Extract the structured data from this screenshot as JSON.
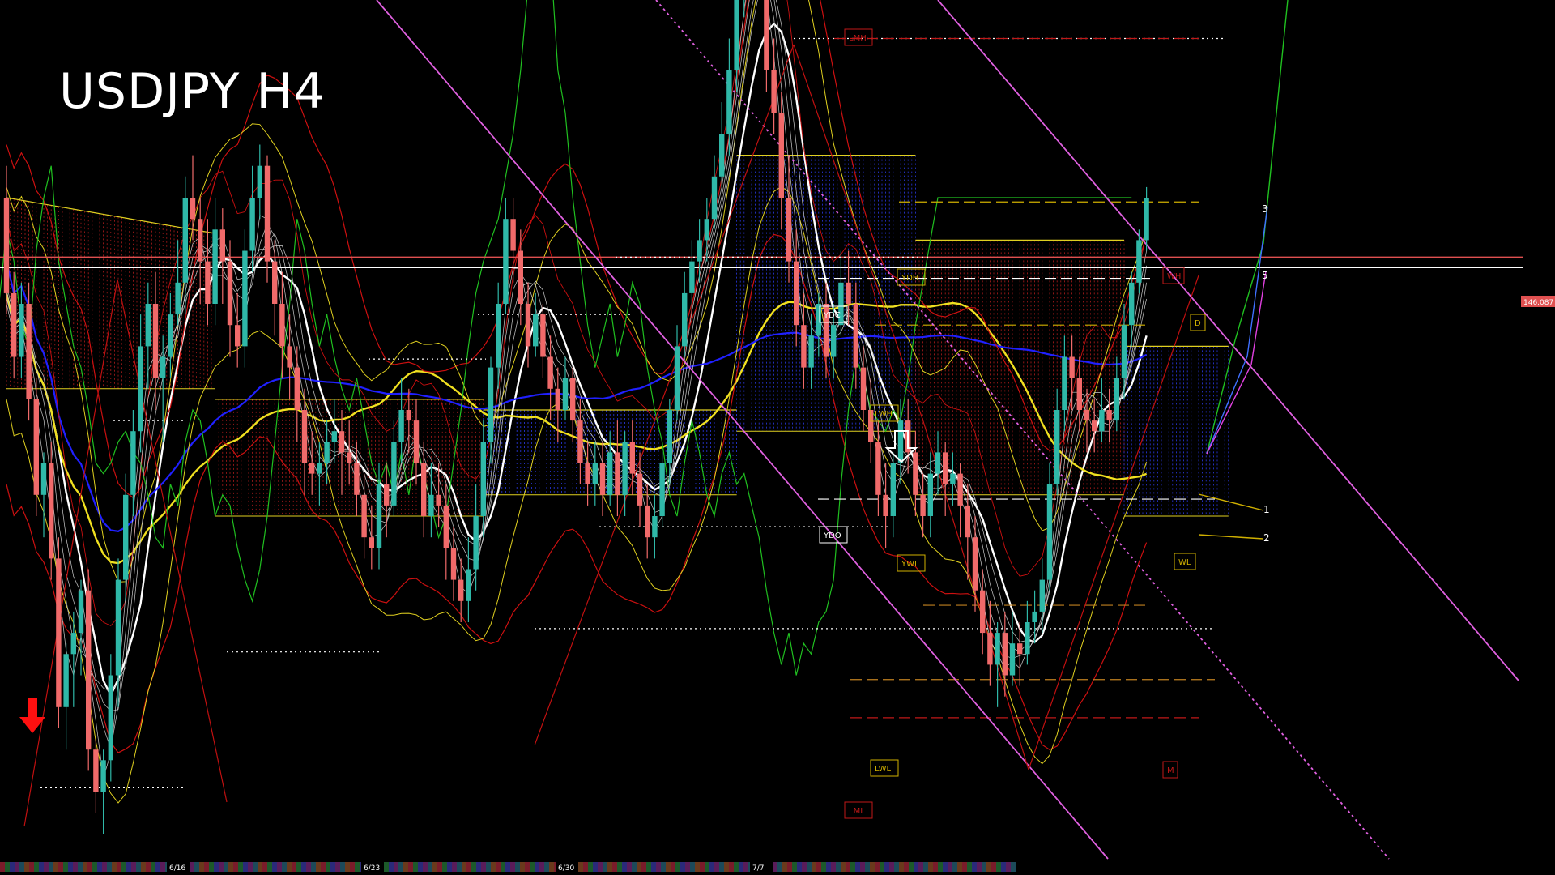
{
  "chart_data": {
    "type": "candlestick",
    "title": "USDJPY H4",
    "colors": {
      "bull": "#2fb8a8",
      "bear": "#f06a6a",
      "ma_white": "#ffffff",
      "ma_yellow": "#f0e020",
      "ma_blue": "#2020ff",
      "green": "#20c020",
      "red_env": "#cc1010",
      "cloud_red": "#c02020",
      "cloud_blue": "#3040ff",
      "cloud_edge": "#e0d020",
      "trend_violet": "#e060e0",
      "level_white": "#ffffff",
      "price_line": "#e05050"
    },
    "price_tag": "146.087",
    "date_labels": [
      "6/16",
      "6/23",
      "6/30",
      "7/7"
    ],
    "level_tags": [
      "LMH",
      "YDH",
      "YDC",
      "YDO",
      "LWH",
      "YWL",
      "LWL",
      "LML",
      "WH",
      "WL",
      "D",
      "M"
    ],
    "projection_labels": [
      "3",
      "5",
      "1",
      "2"
    ],
    "candles": [
      [
        300,
        255,
        315,
        245
      ],
      [
        255,
        225,
        265,
        215
      ],
      [
        225,
        250,
        260,
        215
      ],
      [
        250,
        205,
        260,
        195
      ],
      [
        205,
        160,
        215,
        150
      ],
      [
        160,
        175,
        180,
        140
      ],
      [
        175,
        130,
        185,
        120
      ],
      [
        130,
        60,
        140,
        50
      ],
      [
        60,
        85,
        90,
        40
      ],
      [
        85,
        95,
        105,
        60
      ],
      [
        95,
        115,
        120,
        75
      ],
      [
        115,
        40,
        125,
        30
      ],
      [
        40,
        20,
        45,
        10
      ],
      [
        20,
        35,
        40,
        0
      ],
      [
        35,
        75,
        85,
        25
      ],
      [
        75,
        120,
        130,
        60
      ],
      [
        120,
        160,
        170,
        110
      ],
      [
        160,
        190,
        200,
        150
      ],
      [
        190,
        230,
        245,
        180
      ],
      [
        230,
        250,
        260,
        210
      ],
      [
        250,
        215,
        265,
        200
      ],
      [
        215,
        225,
        235,
        185
      ],
      [
        225,
        245,
        255,
        215
      ],
      [
        245,
        260,
        280,
        240
      ],
      [
        260,
        300,
        310,
        245
      ],
      [
        300,
        290,
        320,
        280
      ],
      [
        290,
        270,
        300,
        250
      ],
      [
        270,
        250,
        290,
        240
      ],
      [
        250,
        285,
        300,
        240
      ],
      [
        285,
        270,
        295,
        250
      ],
      [
        270,
        240,
        280,
        225
      ],
      [
        240,
        230,
        255,
        220
      ],
      [
        230,
        275,
        285,
        220
      ],
      [
        275,
        300,
        315,
        265
      ],
      [
        300,
        315,
        325,
        290
      ],
      [
        315,
        270,
        320,
        260
      ],
      [
        270,
        250,
        280,
        235
      ],
      [
        250,
        230,
        265,
        215
      ],
      [
        230,
        220,
        245,
        205
      ],
      [
        220,
        200,
        230,
        185
      ],
      [
        200,
        175,
        210,
        160
      ],
      [
        175,
        170,
        190,
        160
      ],
      [
        170,
        175,
        185,
        155
      ],
      [
        175,
        185,
        195,
        165
      ],
      [
        185,
        190,
        205,
        175
      ],
      [
        190,
        180,
        200,
        160
      ],
      [
        180,
        175,
        195,
        165
      ],
      [
        175,
        160,
        185,
        150
      ],
      [
        160,
        140,
        170,
        130
      ],
      [
        140,
        135,
        155,
        125
      ],
      [
        135,
        165,
        175,
        125
      ],
      [
        165,
        155,
        175,
        140
      ],
      [
        155,
        185,
        195,
        150
      ],
      [
        185,
        200,
        215,
        175
      ],
      [
        200,
        195,
        210,
        180
      ],
      [
        195,
        175,
        205,
        165
      ],
      [
        175,
        150,
        185,
        140
      ],
      [
        150,
        160,
        175,
        140
      ],
      [
        160,
        155,
        175,
        145
      ],
      [
        155,
        135,
        165,
        120
      ],
      [
        135,
        120,
        145,
        110
      ],
      [
        120,
        110,
        130,
        100
      ],
      [
        110,
        125,
        140,
        100
      ],
      [
        125,
        150,
        165,
        115
      ],
      [
        150,
        185,
        195,
        140
      ],
      [
        185,
        220,
        225,
        175
      ],
      [
        220,
        250,
        260,
        210
      ],
      [
        250,
        290,
        300,
        245
      ],
      [
        290,
        275,
        300,
        260
      ],
      [
        275,
        250,
        285,
        240
      ],
      [
        250,
        230,
        260,
        220
      ],
      [
        230,
        245,
        255,
        225
      ],
      [
        245,
        225,
        250,
        215
      ],
      [
        225,
        210,
        235,
        195
      ],
      [
        210,
        200,
        220,
        185
      ],
      [
        200,
        215,
        225,
        195
      ],
      [
        215,
        195,
        220,
        185
      ],
      [
        195,
        175,
        205,
        165
      ],
      [
        175,
        165,
        185,
        155
      ],
      [
        165,
        175,
        185,
        155
      ],
      [
        175,
        160,
        185,
        150
      ],
      [
        160,
        180,
        190,
        155
      ],
      [
        180,
        160,
        195,
        150
      ],
      [
        160,
        185,
        190,
        150
      ],
      [
        185,
        170,
        195,
        160
      ],
      [
        170,
        155,
        180,
        145
      ],
      [
        155,
        140,
        165,
        130
      ],
      [
        140,
        150,
        160,
        130
      ],
      [
        150,
        175,
        180,
        145
      ],
      [
        175,
        200,
        205,
        165
      ],
      [
        200,
        230,
        240,
        195
      ],
      [
        230,
        255,
        265,
        225
      ],
      [
        255,
        270,
        280,
        245
      ],
      [
        270,
        280,
        290,
        260
      ],
      [
        280,
        290,
        300,
        270
      ],
      [
        290,
        310,
        320,
        285
      ],
      [
        310,
        330,
        345,
        305
      ],
      [
        330,
        360,
        375,
        320
      ],
      [
        360,
        400,
        420,
        350
      ],
      [
        400,
        420,
        430,
        385
      ],
      [
        420,
        430,
        445,
        410
      ],
      [
        430,
        415,
        440,
        400
      ],
      [
        415,
        360,
        420,
        350
      ],
      [
        360,
        340,
        375,
        330
      ],
      [
        340,
        300,
        350,
        285
      ],
      [
        300,
        270,
        320,
        260
      ],
      [
        270,
        240,
        285,
        230
      ],
      [
        240,
        220,
        255,
        210
      ],
      [
        220,
        235,
        245,
        210
      ],
      [
        235,
        250,
        255,
        225
      ],
      [
        250,
        225,
        260,
        215
      ],
      [
        225,
        240,
        250,
        215
      ],
      [
        240,
        260,
        275,
        235
      ],
      [
        260,
        250,
        275,
        240
      ],
      [
        250,
        220,
        260,
        210
      ],
      [
        220,
        200,
        230,
        190
      ],
      [
        200,
        185,
        215,
        175
      ],
      [
        185,
        160,
        195,
        150
      ],
      [
        160,
        150,
        175,
        135
      ],
      [
        150,
        175,
        180,
        140
      ],
      [
        175,
        195,
        205,
        165
      ],
      [
        195,
        180,
        205,
        170
      ],
      [
        180,
        160,
        190,
        150
      ],
      [
        160,
        150,
        170,
        140
      ],
      [
        150,
        170,
        180,
        140
      ],
      [
        170,
        180,
        190,
        160
      ],
      [
        180,
        165,
        185,
        150
      ],
      [
        165,
        170,
        180,
        155
      ],
      [
        170,
        155,
        175,
        140
      ],
      [
        155,
        140,
        165,
        120
      ],
      [
        140,
        115,
        150,
        105
      ],
      [
        115,
        95,
        125,
        85
      ],
      [
        95,
        80,
        110,
        70
      ],
      [
        80,
        95,
        100,
        60
      ],
      [
        95,
        75,
        105,
        65
      ],
      [
        75,
        90,
        105,
        70
      ],
      [
        90,
        85,
        100,
        70
      ],
      [
        85,
        100,
        110,
        80
      ],
      [
        100,
        105,
        115,
        90
      ],
      [
        105,
        120,
        130,
        95
      ],
      [
        120,
        165,
        175,
        115
      ],
      [
        165,
        200,
        210,
        160
      ],
      [
        200,
        225,
        235,
        190
      ],
      [
        225,
        215,
        235,
        200
      ],
      [
        215,
        200,
        225,
        190
      ],
      [
        200,
        195,
        210,
        180
      ],
      [
        195,
        190,
        205,
        180
      ],
      [
        190,
        200,
        215,
        185
      ],
      [
        200,
        195,
        210,
        185
      ],
      [
        195,
        215,
        225,
        190
      ],
      [
        215,
        240,
        250,
        205
      ],
      [
        240,
        260,
        265,
        230
      ],
      [
        260,
        280,
        285,
        255
      ],
      [
        280,
        300,
        305,
        275
      ]
    ]
  }
}
